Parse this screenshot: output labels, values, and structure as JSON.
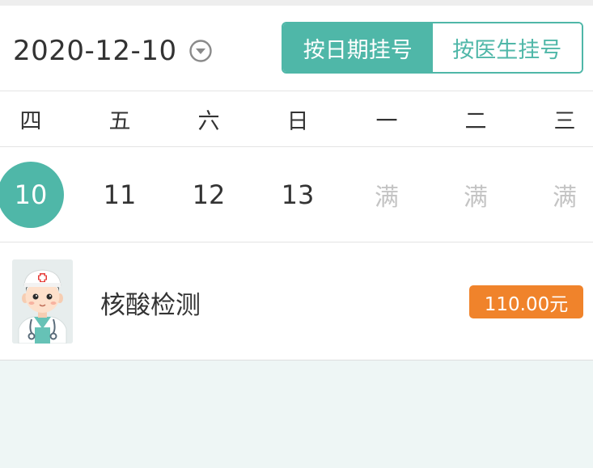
{
  "header": {
    "date": "2020-12-10",
    "tabs": [
      {
        "label": "按日期挂号",
        "active": true
      },
      {
        "label": "按医生挂号",
        "active": false
      }
    ]
  },
  "calendar": {
    "weekdays": [
      "四",
      "五",
      "六",
      "日",
      "一",
      "二",
      "三"
    ],
    "days": [
      {
        "label": "10",
        "state": "selected"
      },
      {
        "label": "11",
        "state": "available"
      },
      {
        "label": "12",
        "state": "available"
      },
      {
        "label": "13",
        "state": "available"
      },
      {
        "label": "满",
        "state": "full"
      },
      {
        "label": "满",
        "state": "full"
      },
      {
        "label": "满",
        "state": "full"
      }
    ]
  },
  "service": {
    "name": "核酸检测",
    "price": "110.00元",
    "avatar_icon": "doctor-avatar-icon"
  },
  "colors": {
    "accent": "#4fb7a8",
    "price_badge": "#f0832b",
    "full_text": "#c4c4c4"
  }
}
